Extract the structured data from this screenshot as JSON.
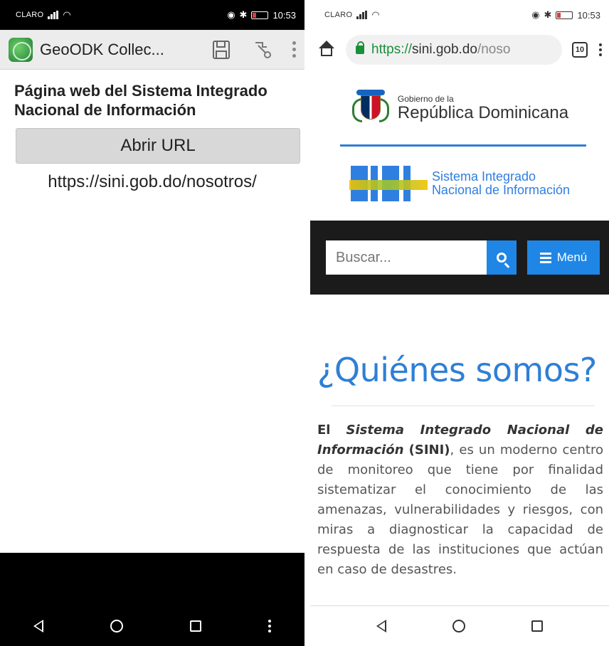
{
  "left": {
    "status": {
      "carrier": "CLARO",
      "time": "10:53"
    },
    "toolbar": {
      "app_title": "GeoODK Collec...",
      "save_icon": "floppy-disk-icon",
      "goto_icon": "forward-jump-icon",
      "menu_icon": "overflow-menu-icon"
    },
    "question": "Página web del Sistema Integrado Nacional de Información",
    "button_label": "Abrir URL",
    "url": "https://sini.gob.do/nosotros/",
    "nav": {
      "back": "back-icon",
      "home": "home-icon",
      "recent": "recent-apps-icon",
      "more": "more-icon"
    }
  },
  "right": {
    "status": {
      "carrier": "CLARO",
      "time": "10:53"
    },
    "browser": {
      "url_scheme": "https://",
      "url_host": "sini.gob.do",
      "url_rest": "/noso",
      "tab_count": "10"
    },
    "gov": {
      "line1": "Gobierno de la",
      "line2": "República Dominicana"
    },
    "sini": {
      "line1": "Sistema Integrado",
      "line2": "Nacional de Información"
    },
    "search": {
      "placeholder": "Buscar...",
      "menu_label": "Menú"
    },
    "page": {
      "title": "¿Quiénes somos?",
      "para_lead": "El",
      "para_em": "Sistema Integrado Nacional de Información",
      "para_bold": "(SINI)",
      "para_rest": ", es un moderno centro de monitoreo que tiene por finalidad sistematizar el conocimiento de las amenazas, vulnerabilidades y riesgos, con miras a diagnosticar la capacidad de respuesta de las instituciones que actúan en caso de desastres."
    }
  },
  "colors": {
    "accent_blue": "#2e7fd6",
    "button_blue": "#1f86e6",
    "secure_green": "#1a8f3a"
  }
}
